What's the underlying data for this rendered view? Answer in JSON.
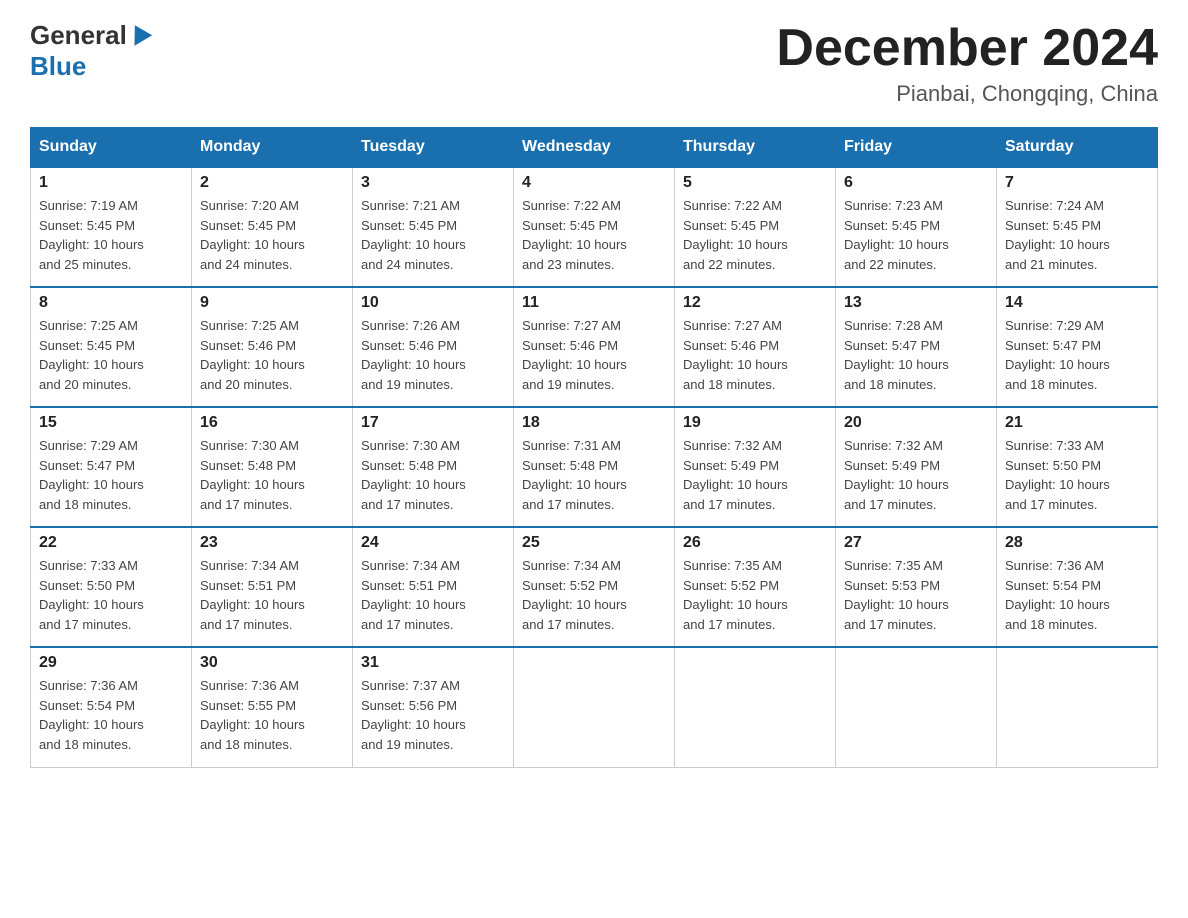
{
  "logo": {
    "general": "General",
    "blue": "Blue"
  },
  "header": {
    "month": "December 2024",
    "location": "Pianbai, Chongqing, China"
  },
  "days_of_week": [
    "Sunday",
    "Monday",
    "Tuesday",
    "Wednesday",
    "Thursday",
    "Friday",
    "Saturday"
  ],
  "weeks": [
    [
      {
        "day": "1",
        "sunrise": "7:19 AM",
        "sunset": "5:45 PM",
        "daylight": "10 hours and 25 minutes."
      },
      {
        "day": "2",
        "sunrise": "7:20 AM",
        "sunset": "5:45 PM",
        "daylight": "10 hours and 24 minutes."
      },
      {
        "day": "3",
        "sunrise": "7:21 AM",
        "sunset": "5:45 PM",
        "daylight": "10 hours and 24 minutes."
      },
      {
        "day": "4",
        "sunrise": "7:22 AM",
        "sunset": "5:45 PM",
        "daylight": "10 hours and 23 minutes."
      },
      {
        "day": "5",
        "sunrise": "7:22 AM",
        "sunset": "5:45 PM",
        "daylight": "10 hours and 22 minutes."
      },
      {
        "day": "6",
        "sunrise": "7:23 AM",
        "sunset": "5:45 PM",
        "daylight": "10 hours and 22 minutes."
      },
      {
        "day": "7",
        "sunrise": "7:24 AM",
        "sunset": "5:45 PM",
        "daylight": "10 hours and 21 minutes."
      }
    ],
    [
      {
        "day": "8",
        "sunrise": "7:25 AM",
        "sunset": "5:45 PM",
        "daylight": "10 hours and 20 minutes."
      },
      {
        "day": "9",
        "sunrise": "7:25 AM",
        "sunset": "5:46 PM",
        "daylight": "10 hours and 20 minutes."
      },
      {
        "day": "10",
        "sunrise": "7:26 AM",
        "sunset": "5:46 PM",
        "daylight": "10 hours and 19 minutes."
      },
      {
        "day": "11",
        "sunrise": "7:27 AM",
        "sunset": "5:46 PM",
        "daylight": "10 hours and 19 minutes."
      },
      {
        "day": "12",
        "sunrise": "7:27 AM",
        "sunset": "5:46 PM",
        "daylight": "10 hours and 18 minutes."
      },
      {
        "day": "13",
        "sunrise": "7:28 AM",
        "sunset": "5:47 PM",
        "daylight": "10 hours and 18 minutes."
      },
      {
        "day": "14",
        "sunrise": "7:29 AM",
        "sunset": "5:47 PM",
        "daylight": "10 hours and 18 minutes."
      }
    ],
    [
      {
        "day": "15",
        "sunrise": "7:29 AM",
        "sunset": "5:47 PM",
        "daylight": "10 hours and 18 minutes."
      },
      {
        "day": "16",
        "sunrise": "7:30 AM",
        "sunset": "5:48 PM",
        "daylight": "10 hours and 17 minutes."
      },
      {
        "day": "17",
        "sunrise": "7:30 AM",
        "sunset": "5:48 PM",
        "daylight": "10 hours and 17 minutes."
      },
      {
        "day": "18",
        "sunrise": "7:31 AM",
        "sunset": "5:48 PM",
        "daylight": "10 hours and 17 minutes."
      },
      {
        "day": "19",
        "sunrise": "7:32 AM",
        "sunset": "5:49 PM",
        "daylight": "10 hours and 17 minutes."
      },
      {
        "day": "20",
        "sunrise": "7:32 AM",
        "sunset": "5:49 PM",
        "daylight": "10 hours and 17 minutes."
      },
      {
        "day": "21",
        "sunrise": "7:33 AM",
        "sunset": "5:50 PM",
        "daylight": "10 hours and 17 minutes."
      }
    ],
    [
      {
        "day": "22",
        "sunrise": "7:33 AM",
        "sunset": "5:50 PM",
        "daylight": "10 hours and 17 minutes."
      },
      {
        "day": "23",
        "sunrise": "7:34 AM",
        "sunset": "5:51 PM",
        "daylight": "10 hours and 17 minutes."
      },
      {
        "day": "24",
        "sunrise": "7:34 AM",
        "sunset": "5:51 PM",
        "daylight": "10 hours and 17 minutes."
      },
      {
        "day": "25",
        "sunrise": "7:34 AM",
        "sunset": "5:52 PM",
        "daylight": "10 hours and 17 minutes."
      },
      {
        "day": "26",
        "sunrise": "7:35 AM",
        "sunset": "5:52 PM",
        "daylight": "10 hours and 17 minutes."
      },
      {
        "day": "27",
        "sunrise": "7:35 AM",
        "sunset": "5:53 PM",
        "daylight": "10 hours and 17 minutes."
      },
      {
        "day": "28",
        "sunrise": "7:36 AM",
        "sunset": "5:54 PM",
        "daylight": "10 hours and 18 minutes."
      }
    ],
    [
      {
        "day": "29",
        "sunrise": "7:36 AM",
        "sunset": "5:54 PM",
        "daylight": "10 hours and 18 minutes."
      },
      {
        "day": "30",
        "sunrise": "7:36 AM",
        "sunset": "5:55 PM",
        "daylight": "10 hours and 18 minutes."
      },
      {
        "day": "31",
        "sunrise": "7:37 AM",
        "sunset": "5:56 PM",
        "daylight": "10 hours and 19 minutes."
      },
      null,
      null,
      null,
      null
    ]
  ],
  "labels": {
    "sunrise": "Sunrise:",
    "sunset": "Sunset:",
    "daylight": "Daylight:"
  }
}
